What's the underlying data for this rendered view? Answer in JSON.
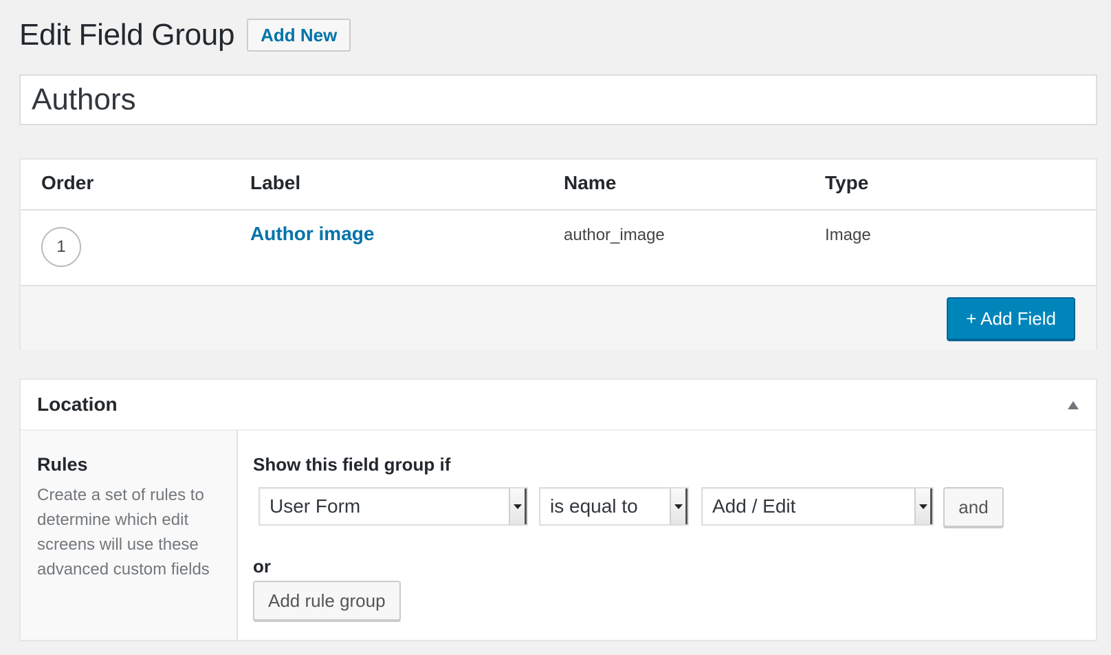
{
  "header": {
    "title": "Edit Field Group",
    "add_new_label": "Add New"
  },
  "field_group": {
    "title_value": "Authors"
  },
  "fields_table": {
    "columns": [
      "Order",
      "Label",
      "Name",
      "Type"
    ],
    "rows": [
      {
        "order": "1",
        "label": "Author image",
        "name": "author_image",
        "type": "Image"
      }
    ],
    "add_field_label": "+ Add Field"
  },
  "location": {
    "title": "Location",
    "rules_title": "Rules",
    "rules_description": "Create a set of rules to determine which edit screens will use these advanced custom fields",
    "show_if_label": "Show this field group if",
    "rule": {
      "param": "User Form",
      "operator": "is equal to",
      "value": "Add / Edit"
    },
    "and_label": "and",
    "or_label": "or",
    "add_rule_group_label": "Add rule group"
  },
  "colors": {
    "link_blue": "#0073aa",
    "primary_button": "#0085ba",
    "background": "#f1f1f1"
  }
}
